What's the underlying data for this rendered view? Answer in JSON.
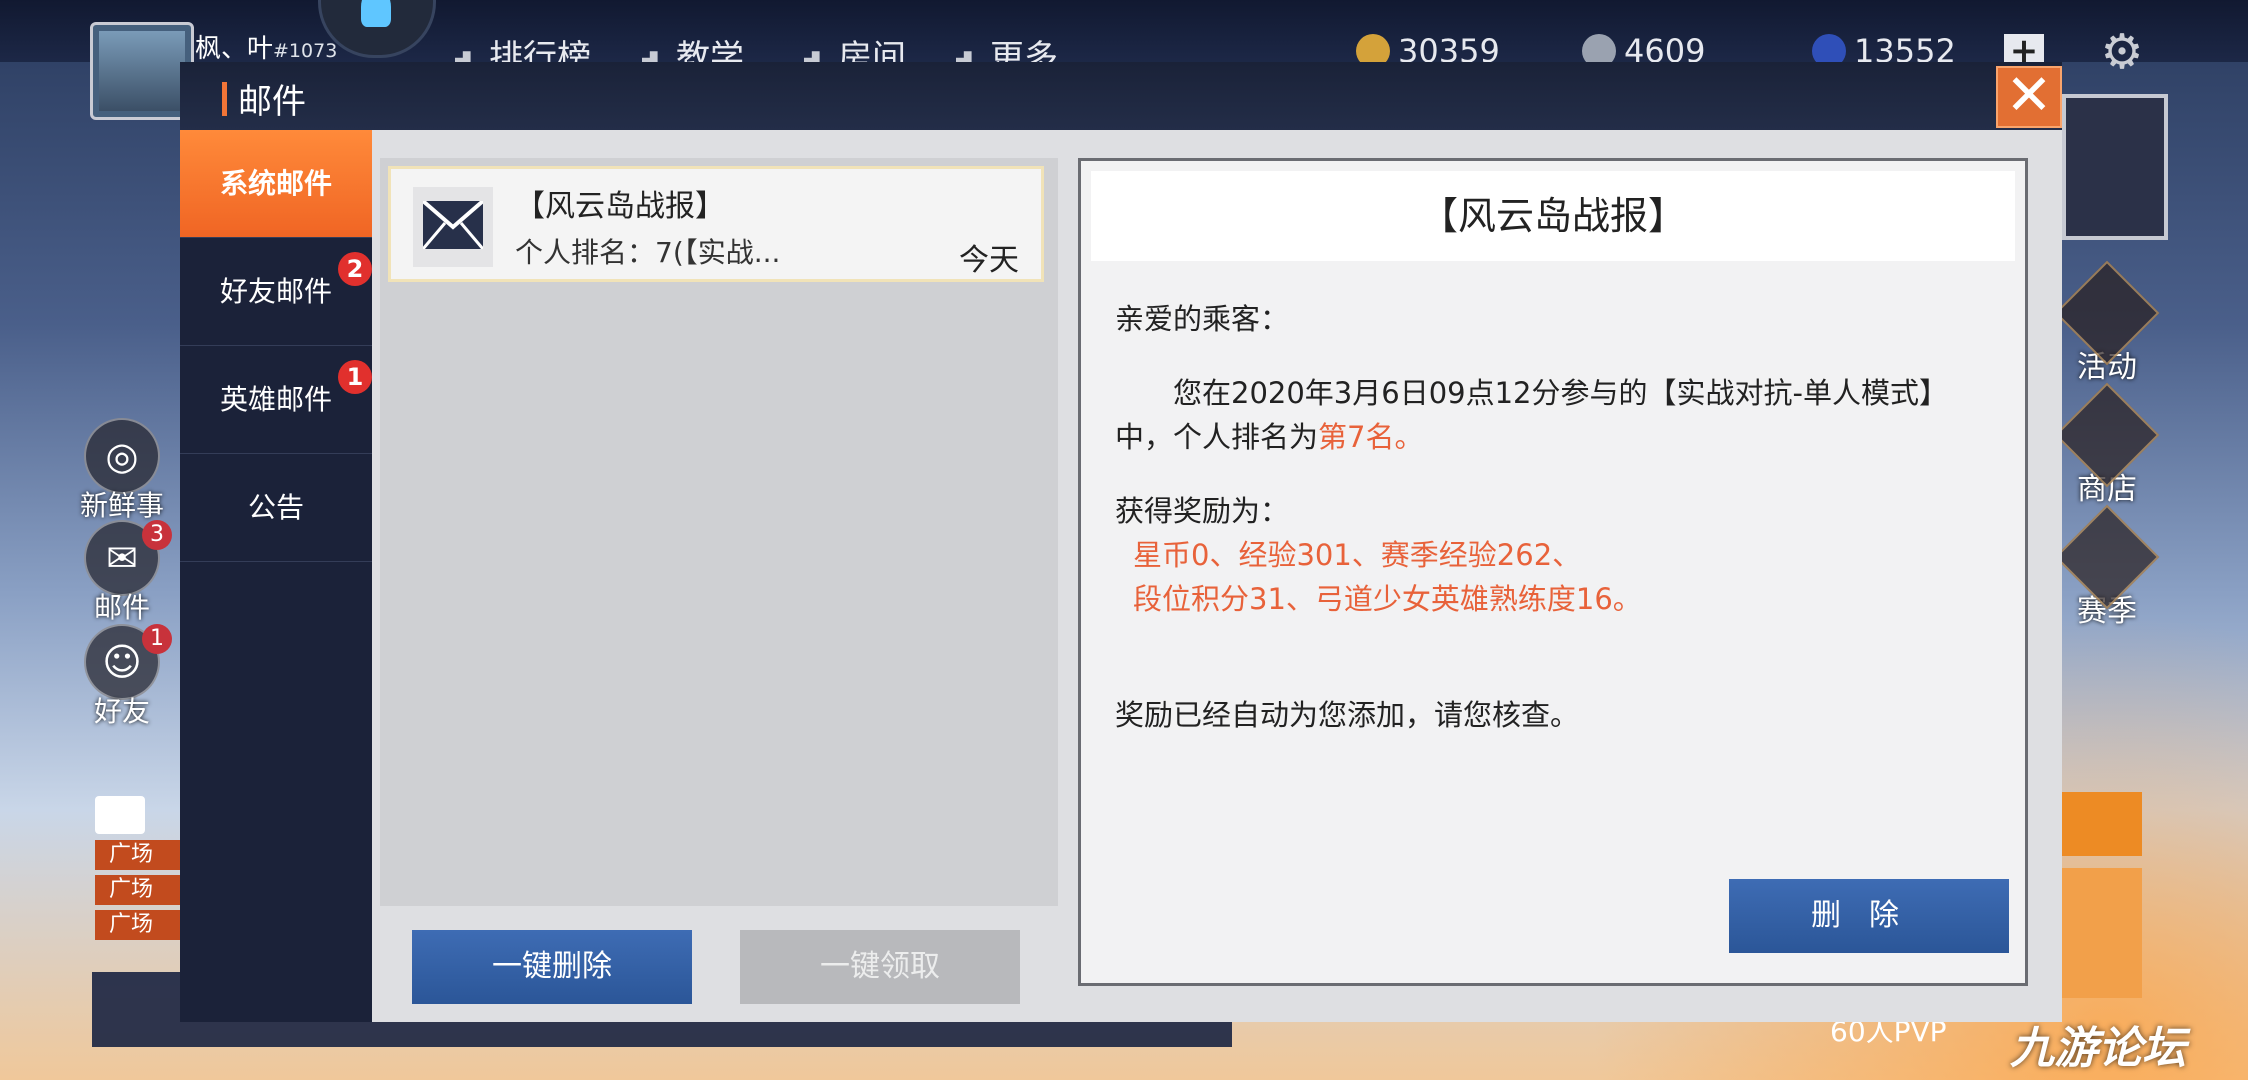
{
  "game_hud": {
    "player_name": "枫、叶",
    "player_id": "#1073",
    "nav": [
      "排行榜",
      "教学",
      "房间",
      "更多"
    ],
    "currency": [
      {
        "icon": "gold-coin-icon",
        "value": "30359",
        "color": "#d4a23a"
      },
      {
        "icon": "feather-icon",
        "value": "4609",
        "color": "#9aa2b0"
      },
      {
        "icon": "gem-icon",
        "value": "13552",
        "color": "#2f4fb8"
      }
    ],
    "plus_label": "+",
    "left_icons": [
      {
        "name": "news",
        "label": "新鲜事",
        "badge": ""
      },
      {
        "name": "mail",
        "label": "邮件",
        "badge": "3"
      },
      {
        "name": "friends",
        "label": "好友",
        "badge": "1"
      }
    ],
    "chat_lines": [
      "广场",
      "广场",
      "广场"
    ],
    "right_icons": [
      {
        "name": "activity",
        "label": "活动"
      },
      {
        "name": "shop",
        "label": "商店"
      },
      {
        "name": "season",
        "label": "赛季"
      }
    ],
    "pvp_label": "60人PVP",
    "watermark": "九游论坛"
  },
  "dialog": {
    "title": "邮件",
    "close_label": "✕",
    "tabs": [
      {
        "label": "系统邮件",
        "badge": "",
        "active": true
      },
      {
        "label": "好友邮件",
        "badge": "2",
        "active": false
      },
      {
        "label": "英雄邮件",
        "badge": "1",
        "active": false
      },
      {
        "label": "公告",
        "badge": "",
        "active": false
      }
    ],
    "mail_list": [
      {
        "title": "【风云岛战报】",
        "preview": "个人排名：7(【实战...",
        "date": "今天"
      }
    ],
    "buttons": {
      "delete_all": "一键删除",
      "claim_all": "一键领取"
    },
    "detail": {
      "title": "【风云岛战报】",
      "greeting": "亲爱的乘客：",
      "body_prefix": "您在2020年3月6日09点12分参与的【实战对抗-单人模式】中，个人排名为",
      "body_rank": "第7名。",
      "reward_heading": "获得奖励为：",
      "reward_line1": "星币0、经验301、赛季经验262、",
      "reward_line2": "段位积分31、弓道少女英雄熟练度16。",
      "footer": "奖励已经自动为您添加，请您核查。",
      "delete_label": "删除"
    }
  }
}
